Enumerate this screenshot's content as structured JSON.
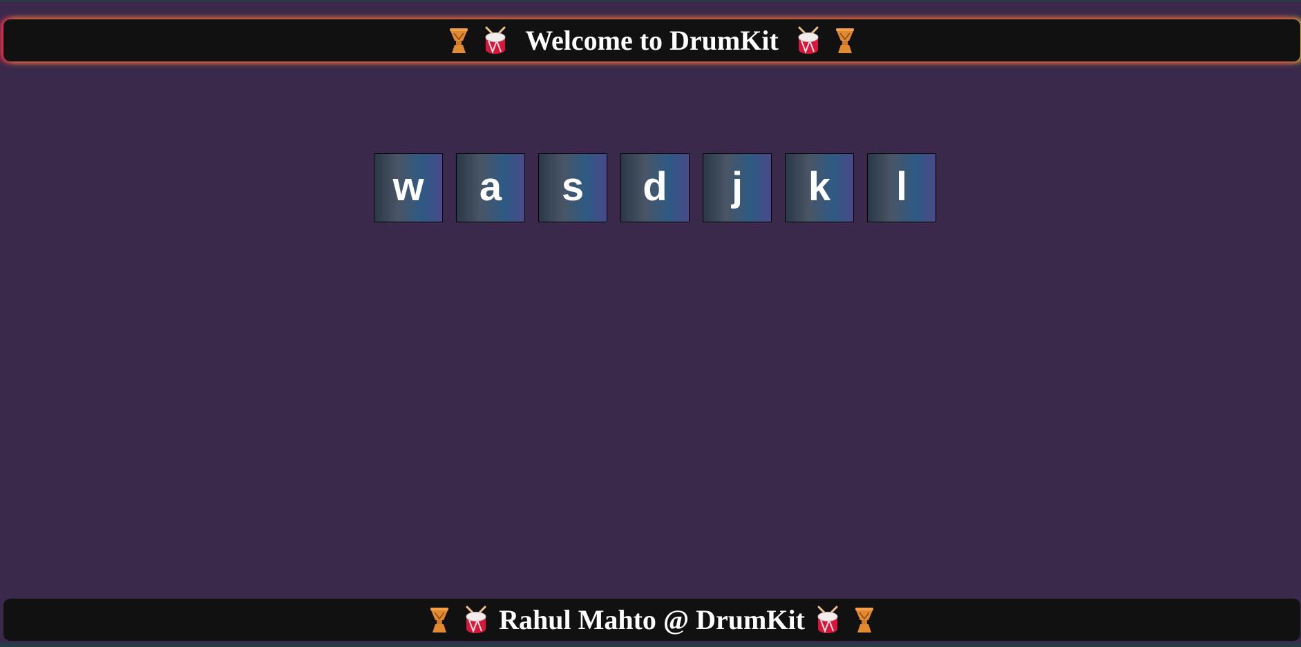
{
  "header": {
    "title": "Welcome to DrumKit",
    "icons_left": [
      "djembe-icon",
      "snare-drum-icon"
    ],
    "icons_right": [
      "snare-drum-icon",
      "djembe-icon"
    ]
  },
  "keys": [
    {
      "label": "w"
    },
    {
      "label": "a"
    },
    {
      "label": "s"
    },
    {
      "label": "d"
    },
    {
      "label": "j"
    },
    {
      "label": "k"
    },
    {
      "label": "l"
    }
  ],
  "footer": {
    "text": "Rahul Mahto @ DrumKit",
    "icons_left": [
      "djembe-icon",
      "snare-drum-icon"
    ],
    "icons_right": [
      "snare-drum-icon",
      "djembe-icon"
    ]
  },
  "colors": {
    "background": "#3a294b",
    "banner": "#111111",
    "glow_left": "#ff2850",
    "glow_right": "#e6dc3c",
    "key_text": "#ffffff"
  }
}
